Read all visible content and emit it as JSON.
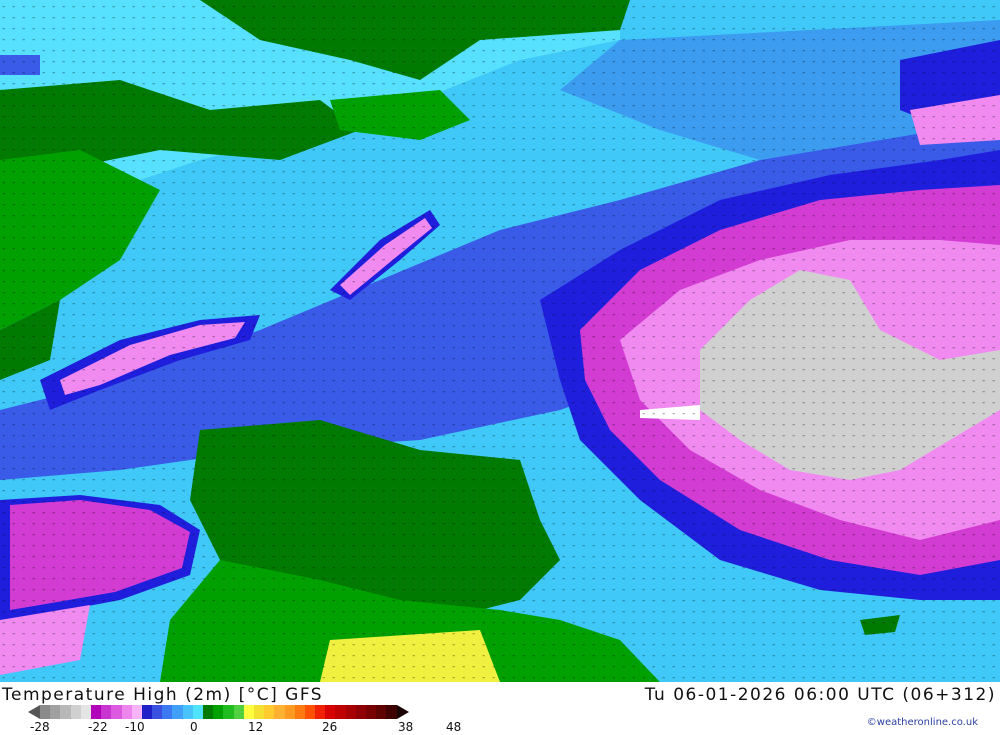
{
  "title": {
    "left": "Temperature High (2m) [°C] GFS",
    "right": "Tu 06-01-2026 06:00 UTC (06+312)"
  },
  "credit": "©weatheronline.co.uk",
  "legend": {
    "colors": [
      "#8a8a8a",
      "#a0a0a0",
      "#b8b8b8",
      "#d0d0d0",
      "#e4e4e4",
      "#b000b8",
      "#c834d0",
      "#dc5ae0",
      "#ec86ec",
      "#f8b4f8",
      "#2020c8",
      "#3a50e0",
      "#3c78f0",
      "#40a0f8",
      "#48c4fa",
      "#50e4ff",
      "#007a00",
      "#00a000",
      "#20bc20",
      "#50d040",
      "#ffff40",
      "#f4e030",
      "#ffcc30",
      "#ffb030",
      "#ff9a20",
      "#ff7a10",
      "#ff5000",
      "#f02000",
      "#d80000",
      "#c00000",
      "#a80000",
      "#900000",
      "#780000",
      "#600000",
      "#400000"
    ],
    "labels": [
      {
        "text": "-28"
      },
      {
        "text": "-22"
      },
      {
        "text": "-10"
      },
      {
        "text": "0"
      },
      {
        "text": "12"
      },
      {
        "text": "26"
      },
      {
        "text": "38"
      },
      {
        "text": "48"
      }
    ]
  },
  "map": {
    "region_colors": {
      "deep_magenta": "#d23cd2",
      "light_magenta": "#f08af0",
      "pale_gray": "#d0d0d0",
      "dark_blue": "#1e1edc",
      "mid_blue": "#3a5ae8",
      "light_blue": "#3c9cf0",
      "cyan": "#40c8f8",
      "pale_cyan": "#58e0ff",
      "dark_green": "#007a00",
      "mid_green": "#00a000",
      "yellow": "#f0f040"
    }
  }
}
